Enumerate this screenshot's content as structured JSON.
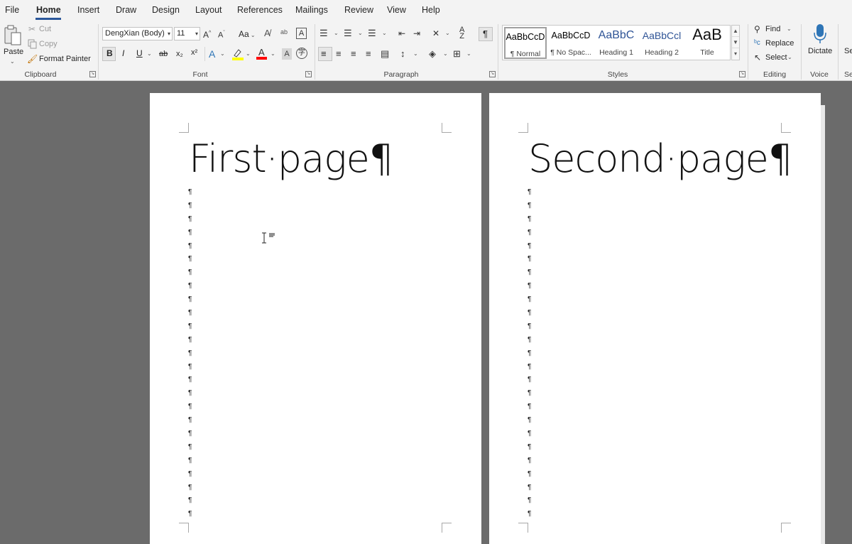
{
  "menu": {
    "tabs": [
      "File",
      "Home",
      "Insert",
      "Draw",
      "Design",
      "Layout",
      "References",
      "Mailings",
      "Review",
      "View",
      "Help"
    ],
    "active_tab": "Home"
  },
  "clipboard": {
    "paste_label": "Paste",
    "cut_label": "Cut",
    "copy_label": "Copy",
    "format_painter_label": "Format Painter",
    "group_label": "Clipboard"
  },
  "font": {
    "font_name": "DengXian (Body)",
    "font_size": "11",
    "change_case": "Aa",
    "bold": "B",
    "italic": "I",
    "underline": "U",
    "strikethrough": "ab",
    "subscript": "x₂",
    "superscript": "x²",
    "group_label": "Font"
  },
  "paragraph": {
    "group_label": "Paragraph",
    "show_marks": "¶"
  },
  "styles": {
    "group_label": "Styles",
    "items": [
      {
        "sample": "AaBbCcD",
        "name": "¶ Normal"
      },
      {
        "sample": "AaBbCcD",
        "name": "¶ No Spac..."
      },
      {
        "sample": "AaBbC",
        "name": "Heading 1"
      },
      {
        "sample": "AaBbCcl",
        "name": "Heading 2"
      },
      {
        "sample": "AaB",
        "name": "Title"
      }
    ]
  },
  "editing": {
    "find_label": "Find",
    "replace_label": "Replace",
    "select_label": "Select",
    "group_label": "Editing"
  },
  "voice": {
    "dictate_label": "Dictate",
    "group_label": "Voice"
  },
  "sensitivity": {
    "label": "Se",
    "group_label": "Se"
  },
  "colors": {
    "accent": "#2b579a",
    "highlight": "#ffff00",
    "font_color": "#ff0000",
    "page": "#ffffff",
    "canvas": "#6b6b6b"
  },
  "pages": [
    {
      "title": "First·page¶",
      "pilcrow_count": 25
    },
    {
      "title": "Second·page¶",
      "pilcrow_count": 25
    }
  ],
  "pilcrow": "¶"
}
